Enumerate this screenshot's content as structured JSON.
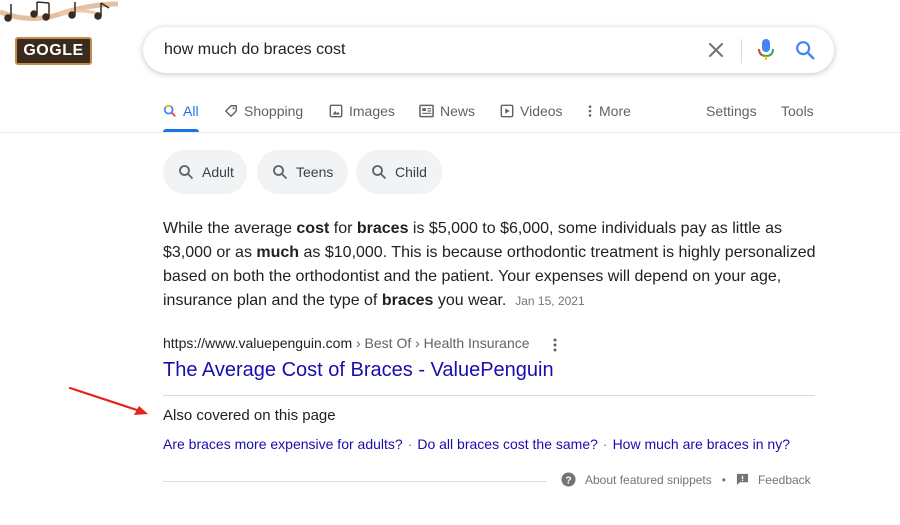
{
  "logo": {
    "text": "GOGLE"
  },
  "search": {
    "query": "how much do braces cost"
  },
  "tabs": [
    {
      "label": "All",
      "icon": "search-icon",
      "active": true
    },
    {
      "label": "Shopping",
      "icon": "tag-icon"
    },
    {
      "label": "Images",
      "icon": "image-icon"
    },
    {
      "label": "News",
      "icon": "newspaper-icon"
    },
    {
      "label": "Videos",
      "icon": "play-icon"
    },
    {
      "label": "More",
      "icon": "more-vert-icon"
    }
  ],
  "tools": {
    "settings": "Settings",
    "tools": "Tools"
  },
  "chips": [
    {
      "label": "Adult"
    },
    {
      "label": "Teens"
    },
    {
      "label": "Child"
    }
  ],
  "snippet": {
    "parts": [
      {
        "text": "While the average ",
        "bold": false
      },
      {
        "text": "cost",
        "bold": true
      },
      {
        "text": " for ",
        "bold": false
      },
      {
        "text": "braces",
        "bold": true
      },
      {
        "text": " is $5,000 to $6,000, some individuals pay as little as $3,000 or as ",
        "bold": false
      },
      {
        "text": "much",
        "bold": true
      },
      {
        "text": " as $10,000. This is because orthodontic treatment is highly personalized based on both the orthodontist and the patient. Your expenses will depend on your age, insurance plan and the type of ",
        "bold": false
      },
      {
        "text": "braces",
        "bold": true
      },
      {
        "text": " you wear.",
        "bold": false
      }
    ],
    "date": "Jan 15, 2021"
  },
  "result": {
    "url": "https://www.valuepenguin.com",
    "breadcrumb": " › Best Of › Health Insurance",
    "title": "The Average Cost of Braces - ValuePenguin"
  },
  "also_covered": {
    "heading": "Also covered on this page",
    "links": [
      "Are braces more expensive for adults?",
      "Do all braces cost the same?",
      "How much are braces in ny?"
    ],
    "separator": "·"
  },
  "footer": {
    "about": "About featured snippets",
    "bullet": "•",
    "feedback": "Feedback"
  },
  "colors": {
    "accent": "#1a73e8",
    "link": "#1a0dab",
    "annotation_arrow": "#e8211d"
  }
}
